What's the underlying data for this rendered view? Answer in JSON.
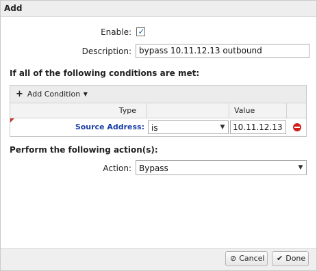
{
  "dialog": {
    "title": "Add"
  },
  "form": {
    "enable_label": "Enable:",
    "enable_checked": true,
    "description_label": "Description:",
    "description_value": "bypass 10.11.12.13 outbound"
  },
  "conditions": {
    "heading": "If all of the following conditions are met:",
    "add_condition_label": "Add Condition",
    "columns": [
      "Type",
      "",
      "Value",
      ""
    ],
    "rows": [
      {
        "type": "Source Address:",
        "operator": "is",
        "value": "10.11.12.13"
      }
    ]
  },
  "actions": {
    "heading": "Perform the following action(s):",
    "action_label": "Action:",
    "action_value": "Bypass"
  },
  "footer": {
    "cancel_label": "Cancel",
    "done_label": "Done"
  },
  "icons": {
    "add": "plus-icon",
    "dropdown": "chevron-down-icon",
    "remove": "remove-icon",
    "cancel": "cancel-icon",
    "done": "checkmark-icon"
  },
  "colors": {
    "link": "#1a3fa6",
    "remove": "#d21d1d",
    "checkbox_mark": "#2a6ab0"
  }
}
